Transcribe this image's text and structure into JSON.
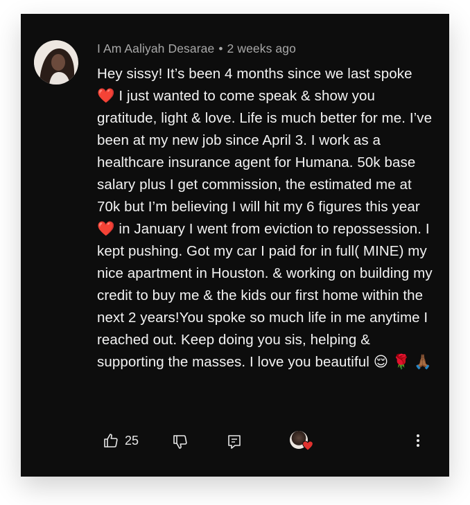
{
  "comment": {
    "author": "I Am Aaliyah Desarae",
    "separator": "•",
    "timestamp": "2 weeks ago",
    "segments": [
      "Hey sissy! It’s been 4 months since we last spoke ",
      " I just wanted to come speak & show you gratitude, light & love. Life is much better for me. I’ve been at my new job since April 3. I work as a healthcare insurance agent for Humana. 50k base salary plus I get commission, the estimated me at 70k but I’m believing I will hit my 6 figures this year ",
      " in January I went from eviction to repossession. I kept pushing. Got my car I paid for in full( MINE) my nice apartment in Houston. & working on building my credit to buy me & the kids our first home within the next 2 years!You spoke so much life in me anytime I reached out. Keep doing you sis, helping & supporting the masses. I love you beautiful "
    ],
    "emojis": [
      "❤️",
      "❤️",
      "😌",
      "🌹",
      "🙏🏾"
    ]
  },
  "actions": {
    "like_count": "25"
  },
  "icons": {
    "avatar": "profile-photo",
    "like": "thumbs-up-icon",
    "dislike": "thumbs-down-icon",
    "reply": "reply-icon",
    "creator_heart": "creator-heart-icon",
    "more": "more-vertical-icon"
  },
  "colors": {
    "background": "#0d0d0d",
    "text": "#f3f3f3",
    "meta": "#a8a8a8",
    "heart": "#e0312e"
  }
}
